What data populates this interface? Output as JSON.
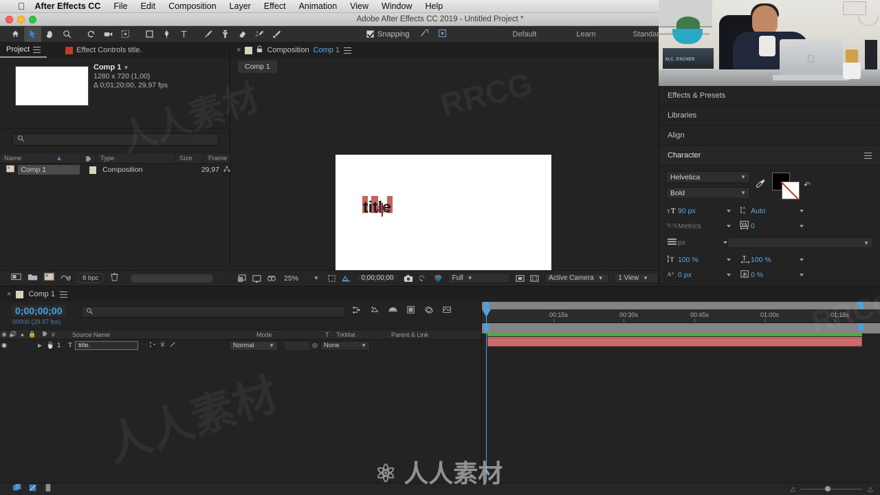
{
  "menubar": {
    "apple_icon": "apple-icon",
    "items": [
      "After Effects CC",
      "File",
      "Edit",
      "Composition",
      "Layer",
      "Effect",
      "Animation",
      "View",
      "Window",
      "Help"
    ]
  },
  "window": {
    "title": "Adobe After Effects CC 2019 - Untitled Project *",
    "traffic": [
      "close",
      "minimize",
      "maximize"
    ]
  },
  "toolbar": {
    "tools": [
      {
        "name": "home-icon",
        "glyph": "⌂"
      },
      {
        "name": "selection-tool-icon",
        "glyph": "➤"
      },
      {
        "name": "hand-tool-icon",
        "glyph": "✋"
      },
      {
        "name": "zoom-tool-icon",
        "glyph": "⌕"
      },
      {
        "name": "rotation-tool-icon",
        "glyph": "↺"
      },
      {
        "name": "camera-tool-icon",
        "glyph": "🎥"
      },
      {
        "name": "pan-behind-tool-icon",
        "glyph": "⌗"
      },
      {
        "name": "shape-tool-icon",
        "glyph": "□"
      },
      {
        "name": "pen-tool-icon",
        "glyph": "✒"
      },
      {
        "name": "type-tool-icon",
        "glyph": "T"
      },
      {
        "name": "brush-tool-icon",
        "glyph": "✐"
      },
      {
        "name": "clone-stamp-tool-icon",
        "glyph": "⚓"
      },
      {
        "name": "eraser-tool-icon",
        "glyph": "▱"
      },
      {
        "name": "roto-brush-tool-icon",
        "glyph": "✨"
      },
      {
        "name": "puppet-tool-icon",
        "glyph": "✎"
      }
    ],
    "snapping_label": "Snapping",
    "snapping_checked": true,
    "workspaces": [
      "Default",
      "Learn",
      "Standard"
    ]
  },
  "project_panel": {
    "tabs": [
      {
        "label": "Project",
        "active": true
      },
      {
        "label": "Effect Controls title.",
        "active": false
      }
    ],
    "comp_preview": {
      "name": "Comp 1",
      "resolution": "1280 x 720 (1,00)",
      "duration": "Δ 0;01;20;00, 29,97 fps"
    },
    "search_placeholder": "",
    "columns": [
      "Name",
      "Type",
      "Size",
      "Frame Ra..."
    ],
    "rows": [
      {
        "name": "Comp 1",
        "type": "Composition",
        "size": "",
        "frame_rate": "29,97"
      }
    ],
    "footer": {
      "bit_depth": "8 bpc",
      "icons": [
        "interpret-footage-icon",
        "new-folder-icon",
        "new-composition-icon",
        "project-settings-icon",
        "delete-icon"
      ]
    }
  },
  "comp_panel": {
    "tab_close": "×",
    "tab_label": "Composition",
    "tab_comp_name": "Comp 1",
    "subtab": "Comp 1",
    "canvas_text": "title",
    "footer": {
      "zoom": "25%",
      "timecode": "0;00;00;00",
      "resolution": "Full",
      "camera": "Active Camera",
      "views": "1 View",
      "icons": [
        "toggle-transparency-grid-icon",
        "toggle-mask-icon",
        "toggle-guides-icon",
        "region-of-interest-icon",
        "snapshot-icon",
        "show-snapshot-icon",
        "channels-icon",
        "toggle-alpha-icon",
        "toggle-render-icon"
      ]
    }
  },
  "right_panel": {
    "accordions": [
      {
        "label": "Effects & Presets",
        "open": false
      },
      {
        "label": "Libraries",
        "open": false
      },
      {
        "label": "Align",
        "open": false
      },
      {
        "label": "Character",
        "open": true
      }
    ],
    "character": {
      "font_family": "Helvetica",
      "font_style": "Bold",
      "font_size": "90 px",
      "leading": "Auto",
      "kerning": "Metrics",
      "tracking": "0",
      "stroke_width_unit": "px",
      "vertical_scale": "100 %",
      "horizontal_scale": "100 %",
      "baseline_shift": "0 px",
      "tsume": "0 %",
      "fill_color": "#000000",
      "stroke_color": "#ffffff"
    }
  },
  "timeline": {
    "tab_close": "×",
    "tab_label": "Comp 1",
    "current_time": "0;00;00;00",
    "frame_info": "00000 (29.97 fps)",
    "search_placeholder": "",
    "columns": [
      "#",
      "Source Name",
      "Mode",
      "T",
      "TrkMat",
      "Parent & Link"
    ],
    "layers": [
      {
        "index": "1",
        "source_name": "title.",
        "type_icon": "T",
        "mode": "Normal",
        "trkmat": "",
        "parent": "None"
      }
    ],
    "ruler_ticks": [
      "00:15s",
      "00:30s",
      "00:45s",
      "01:00s",
      "01:15s"
    ],
    "toolbar_icons": [
      "shy-icon",
      "enable-frame-blending-icon",
      "enable-motion-blur-icon",
      "graph-editor-icon",
      "adjustment-icon",
      "3d-icon"
    ],
    "footer_icons": [
      "toggle-switches-icon",
      "toggle-modes-icon",
      "frame-render-time-icon"
    ]
  },
  "webcam": {
    "alt": "screen recording overlay of a person working at a desk with a laptop",
    "book_text": "M.C. ESCHER"
  },
  "watermarks": [
    "RRCG",
    "人人素材"
  ]
}
